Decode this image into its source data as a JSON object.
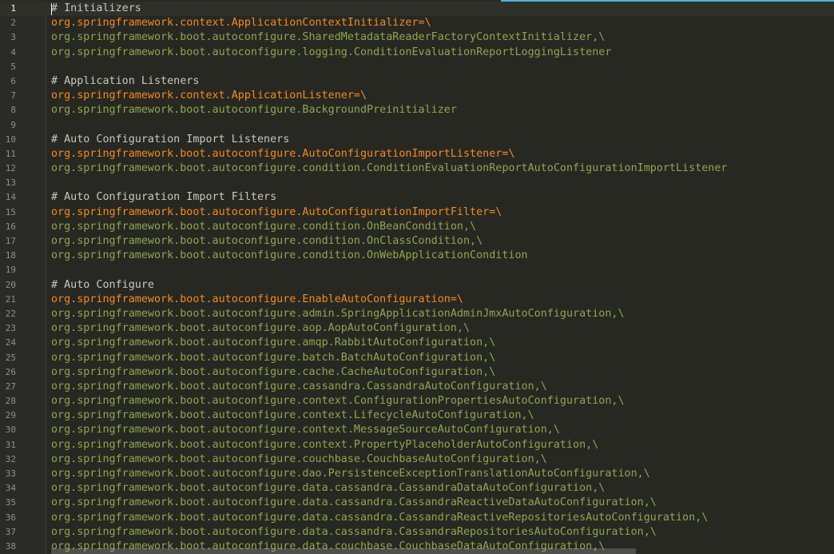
{
  "editor": {
    "colors": {
      "background": "#272822",
      "gutter": "#2a2b26",
      "comment": "#c8c8c0",
      "key": "#f28a24",
      "value": "#8ea651",
      "line_number": "#8f908a",
      "accent": "#4fb3d6"
    },
    "lines": [
      {
        "n": "1",
        "type": "comment",
        "text": "# Initializers"
      },
      {
        "n": "2",
        "type": "key",
        "text": "org.springframework.context.ApplicationContextInitializer=\\"
      },
      {
        "n": "3",
        "type": "value",
        "text": "org.springframework.boot.autoconfigure.SharedMetadataReaderFactoryContextInitializer,\\"
      },
      {
        "n": "4",
        "type": "value",
        "text": "org.springframework.boot.autoconfigure.logging.ConditionEvaluationReportLoggingListener"
      },
      {
        "n": "5",
        "type": "blank",
        "text": ""
      },
      {
        "n": "6",
        "type": "comment",
        "text": "# Application Listeners"
      },
      {
        "n": "7",
        "type": "key",
        "text": "org.springframework.context.ApplicationListener=\\"
      },
      {
        "n": "8",
        "type": "value",
        "text": "org.springframework.boot.autoconfigure.BackgroundPreinitializer"
      },
      {
        "n": "9",
        "type": "blank",
        "text": ""
      },
      {
        "n": "10",
        "type": "comment",
        "text": "# Auto Configuration Import Listeners"
      },
      {
        "n": "11",
        "type": "key",
        "text": "org.springframework.boot.autoconfigure.AutoConfigurationImportListener=\\"
      },
      {
        "n": "12",
        "type": "value",
        "text": "org.springframework.boot.autoconfigure.condition.ConditionEvaluationReportAutoConfigurationImportListener"
      },
      {
        "n": "13",
        "type": "blank",
        "text": ""
      },
      {
        "n": "14",
        "type": "comment",
        "text": "# Auto Configuration Import Filters"
      },
      {
        "n": "15",
        "type": "key",
        "text": "org.springframework.boot.autoconfigure.AutoConfigurationImportFilter=\\"
      },
      {
        "n": "16",
        "type": "value",
        "text": "org.springframework.boot.autoconfigure.condition.OnBeanCondition,\\"
      },
      {
        "n": "17",
        "type": "value",
        "text": "org.springframework.boot.autoconfigure.condition.OnClassCondition,\\"
      },
      {
        "n": "18",
        "type": "value",
        "text": "org.springframework.boot.autoconfigure.condition.OnWebApplicationCondition"
      },
      {
        "n": "19",
        "type": "blank",
        "text": ""
      },
      {
        "n": "20",
        "type": "comment",
        "text": "# Auto Configure"
      },
      {
        "n": "21",
        "type": "key",
        "text": "org.springframework.boot.autoconfigure.EnableAutoConfiguration=\\"
      },
      {
        "n": "22",
        "type": "value",
        "text": "org.springframework.boot.autoconfigure.admin.SpringApplicationAdminJmxAutoConfiguration,\\"
      },
      {
        "n": "23",
        "type": "value",
        "text": "org.springframework.boot.autoconfigure.aop.AopAutoConfiguration,\\"
      },
      {
        "n": "24",
        "type": "value",
        "text": "org.springframework.boot.autoconfigure.amqp.RabbitAutoConfiguration,\\"
      },
      {
        "n": "25",
        "type": "value",
        "text": "org.springframework.boot.autoconfigure.batch.BatchAutoConfiguration,\\"
      },
      {
        "n": "26",
        "type": "value",
        "text": "org.springframework.boot.autoconfigure.cache.CacheAutoConfiguration,\\"
      },
      {
        "n": "27",
        "type": "value",
        "text": "org.springframework.boot.autoconfigure.cassandra.CassandraAutoConfiguration,\\"
      },
      {
        "n": "28",
        "type": "value",
        "text": "org.springframework.boot.autoconfigure.context.ConfigurationPropertiesAutoConfiguration,\\"
      },
      {
        "n": "29",
        "type": "value",
        "text": "org.springframework.boot.autoconfigure.context.LifecycleAutoConfiguration,\\"
      },
      {
        "n": "30",
        "type": "value",
        "text": "org.springframework.boot.autoconfigure.context.MessageSourceAutoConfiguration,\\"
      },
      {
        "n": "31",
        "type": "value",
        "text": "org.springframework.boot.autoconfigure.context.PropertyPlaceholderAutoConfiguration,\\"
      },
      {
        "n": "32",
        "type": "value",
        "text": "org.springframework.boot.autoconfigure.couchbase.CouchbaseAutoConfiguration,\\"
      },
      {
        "n": "33",
        "type": "value",
        "text": "org.springframework.boot.autoconfigure.dao.PersistenceExceptionTranslationAutoConfiguration,\\"
      },
      {
        "n": "34",
        "type": "value",
        "text": "org.springframework.boot.autoconfigure.data.cassandra.CassandraDataAutoConfiguration,\\"
      },
      {
        "n": "35",
        "type": "value",
        "text": "org.springframework.boot.autoconfigure.data.cassandra.CassandraReactiveDataAutoConfiguration,\\"
      },
      {
        "n": "36",
        "type": "value",
        "text": "org.springframework.boot.autoconfigure.data.cassandra.CassandraReactiveRepositoriesAutoConfiguration,\\"
      },
      {
        "n": "37",
        "type": "value",
        "text": "org.springframework.boot.autoconfigure.data.cassandra.CassandraRepositoriesAutoConfiguration,\\"
      },
      {
        "n": "38",
        "type": "value",
        "text": "org.springframework.boot.autoconfigure.data.couchbase.CouchbaseDataAutoConfiguration,\\"
      }
    ]
  }
}
